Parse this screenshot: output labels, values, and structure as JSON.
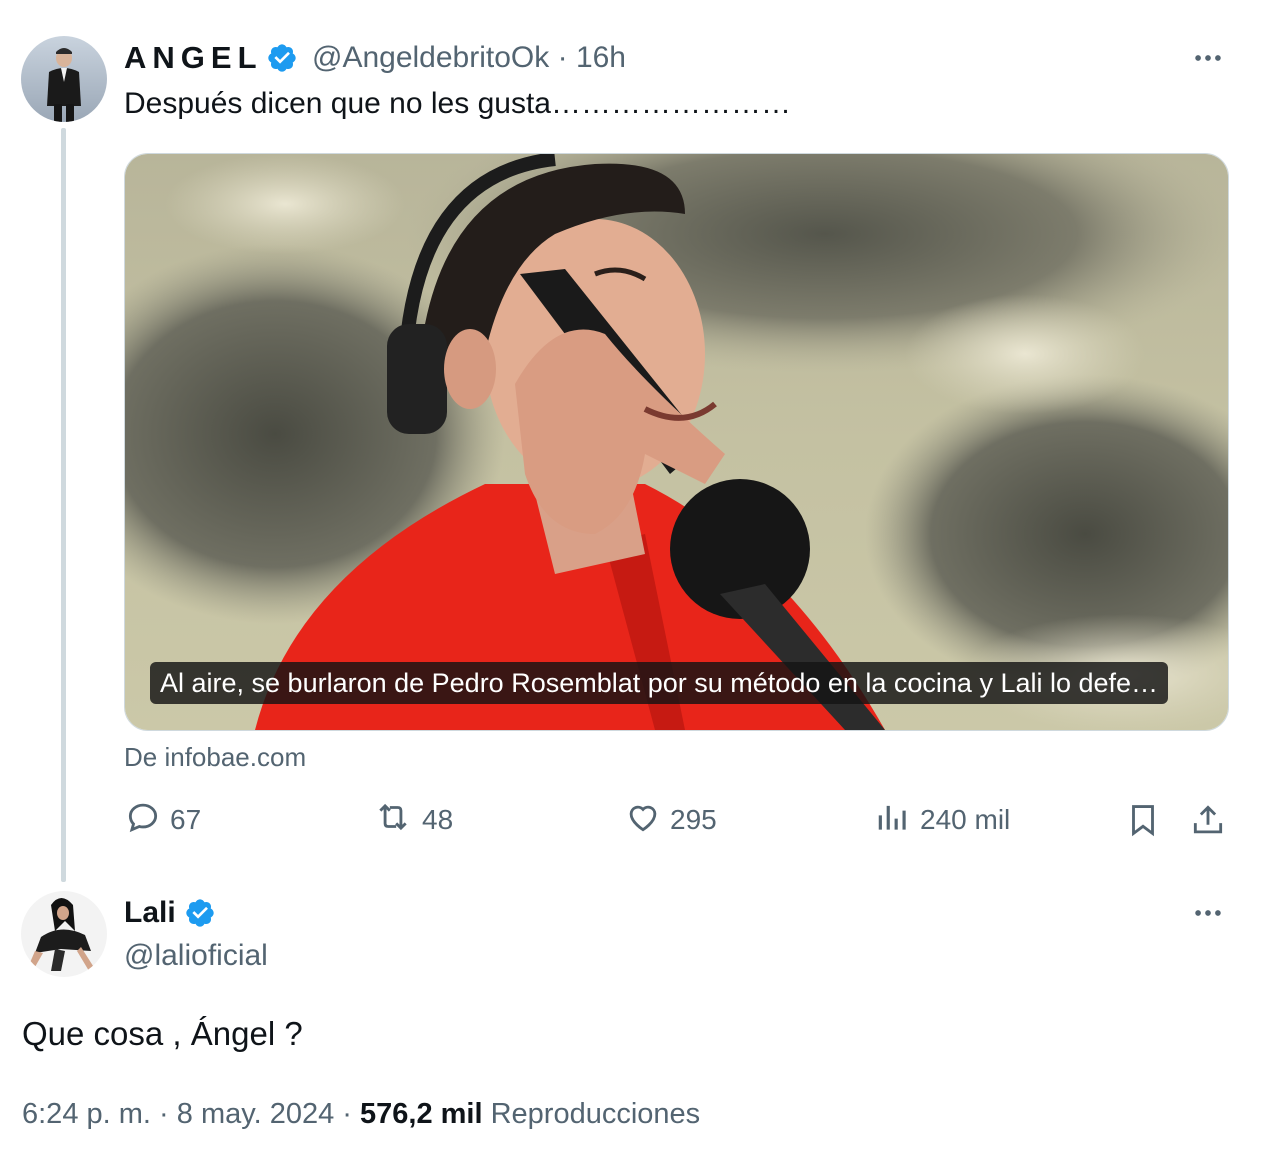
{
  "tweet1": {
    "display_name": "ANGEL",
    "handle": "@AngeldebritoOk",
    "separator": "·",
    "time": "16h",
    "text": "Después dicen que no les gusta……………………",
    "media": {
      "caption": "Al aire, se burlaron de Pedro Rosemblat por su método en la cocina y Lali lo defe…",
      "source": "De infobae.com"
    },
    "actions": {
      "replies": "67",
      "reposts": "48",
      "likes": "295",
      "views": "240 mil"
    }
  },
  "tweet2": {
    "display_name": "Lali",
    "handle": "@lalioficial",
    "text": "Que cosa , Ángel ?",
    "time": "6:24 p. m.",
    "date": "8 may. 2024",
    "separator": "·",
    "views_count": "576,2 mil",
    "views_label": "Reproducciones"
  },
  "colors": {
    "verified_blue": "#1d9bf0",
    "secondary_text": "#536471",
    "primary_text": "#0f1419",
    "thread_line": "#cfd9de"
  },
  "icons": [
    "verified-badge-icon",
    "more-icon",
    "reply-icon",
    "repost-icon",
    "like-icon",
    "views-icon",
    "bookmark-icon",
    "share-icon"
  ]
}
